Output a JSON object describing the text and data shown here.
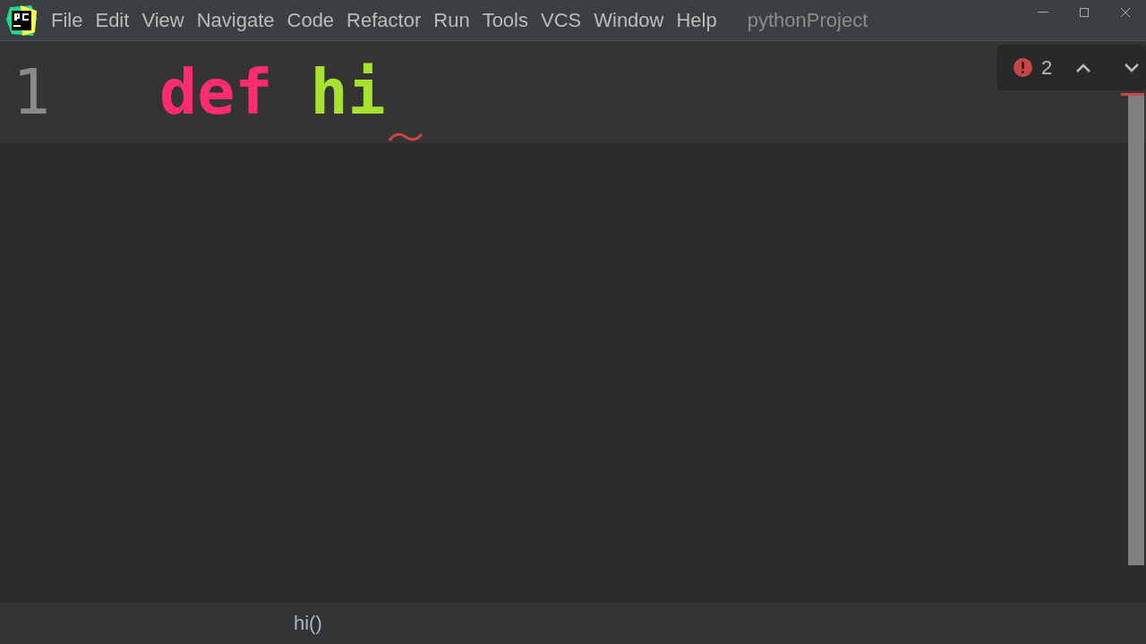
{
  "menu": [
    "File",
    "Edit",
    "View",
    "Navigate",
    "Code",
    "Refactor",
    "Run",
    "Tools",
    "VCS",
    "Window",
    "Help"
  ],
  "window": {
    "title": "pythonProject"
  },
  "editor": {
    "lines": [
      {
        "number": "1",
        "current": true,
        "tokens": [
          {
            "kind": "keyword",
            "text": "def"
          },
          {
            "kind": "function",
            "text": "hi"
          }
        ],
        "error": true
      }
    ]
  },
  "inspections": {
    "error_count": "2"
  },
  "breadcrumb": "hi()"
}
